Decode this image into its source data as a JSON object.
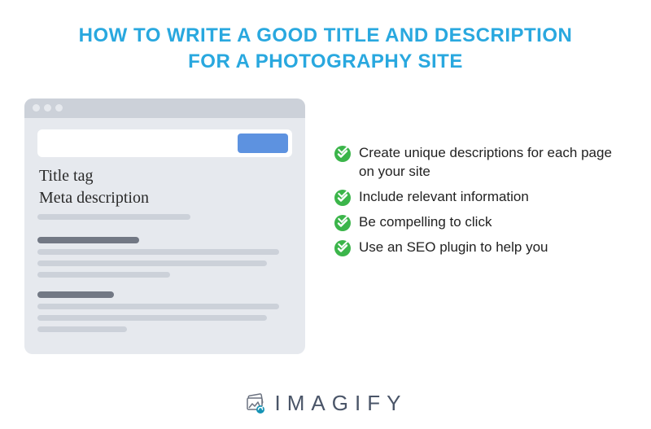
{
  "title": "HOW TO WRITE A GOOD TITLE AND DESCRIPTION FOR A PHOTOGRAPHY SITE",
  "browser": {
    "label_title": "Title tag",
    "label_meta": "Meta description"
  },
  "tips": [
    "Create unique descriptions for each page on your site",
    "Include relevant information",
    "Be compelling to click",
    "Use an SEO plugin to help you"
  ],
  "brand": "IMAGIFY"
}
